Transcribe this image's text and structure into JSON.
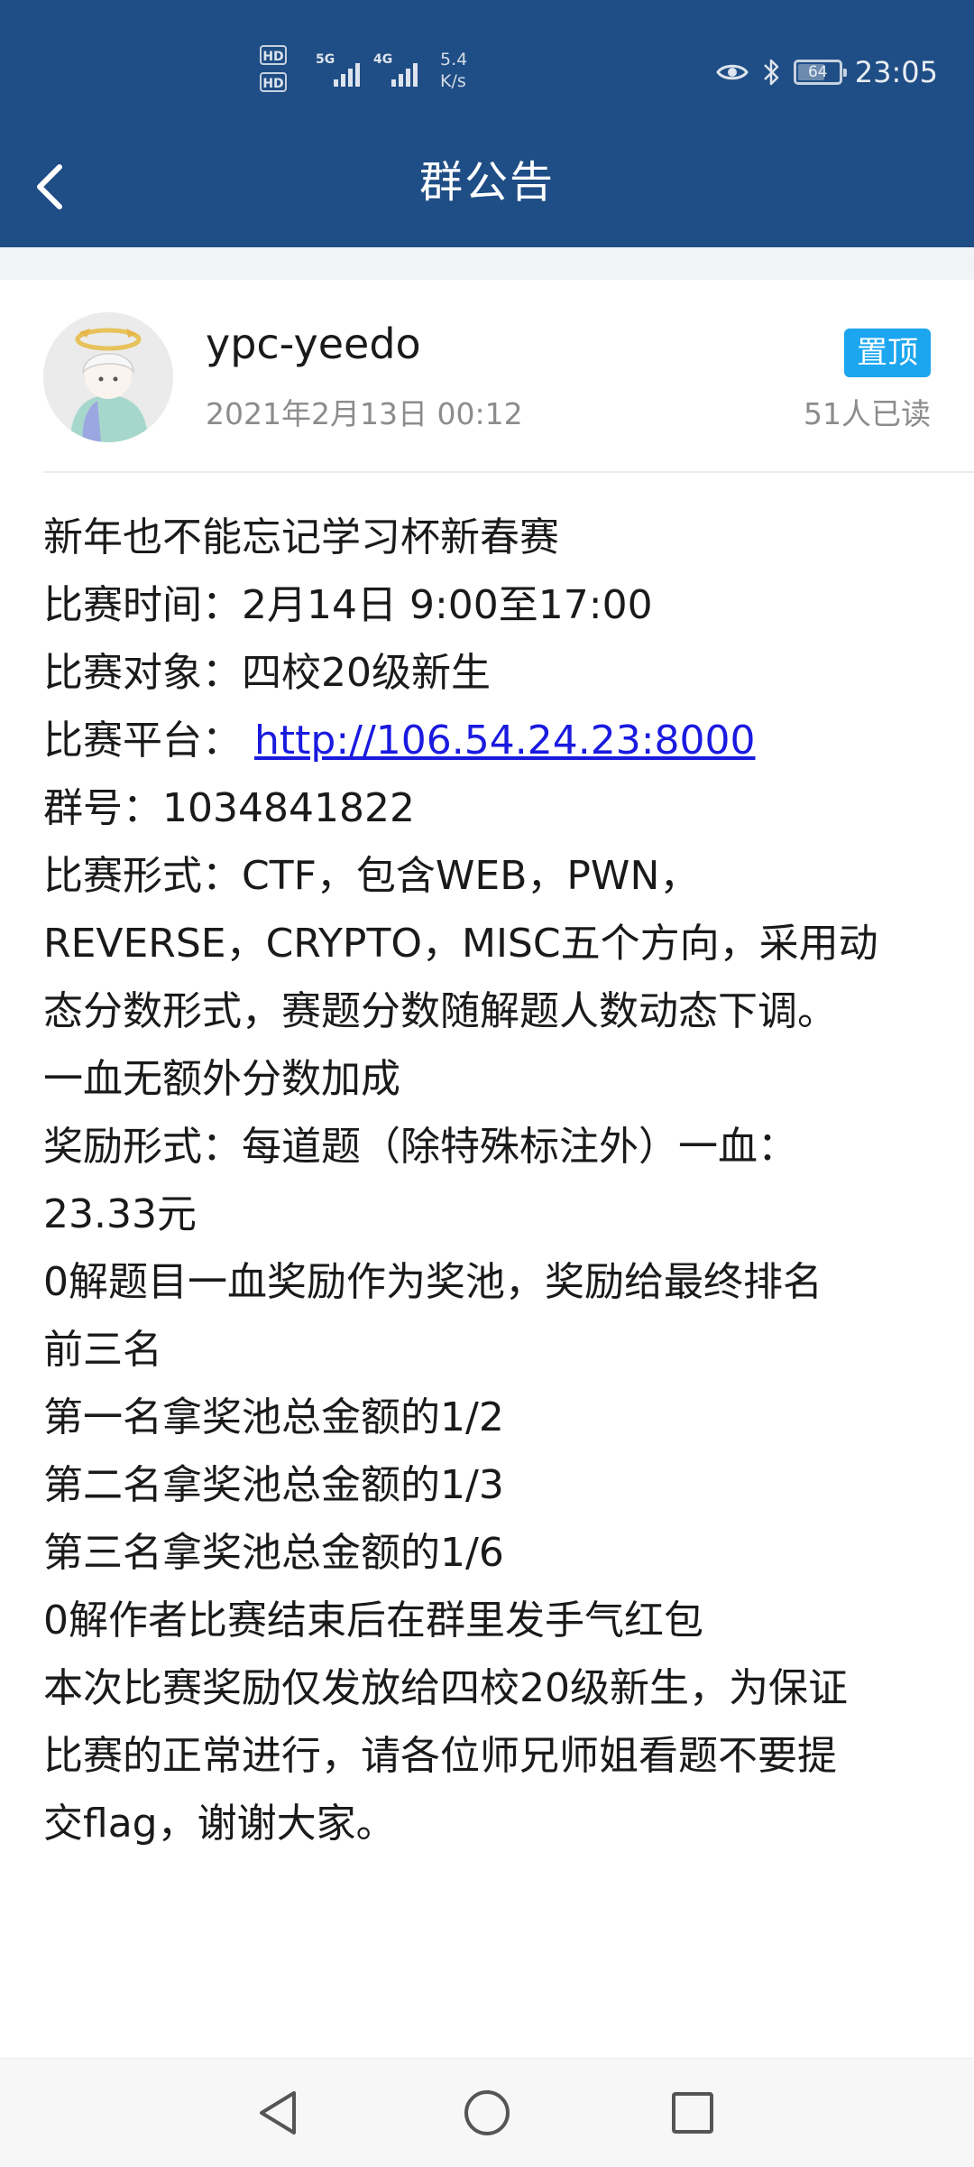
{
  "status_bar": {
    "hd_labels": [
      "HD",
      "HD"
    ],
    "network_5g": "5G",
    "network_4g": "4G",
    "speed_value": "5.4",
    "speed_unit": "K/s",
    "battery": "64",
    "time": "23:05",
    "icons": [
      "eye-icon",
      "bluetooth-icon",
      "battery-icon"
    ]
  },
  "header": {
    "title": "群公告",
    "back_icon": "back-chevron-icon"
  },
  "announcement": {
    "author": "ypc-yeedo",
    "timestamp": "2021年2月13日 00:12",
    "pinned_label": "置顶",
    "read_count": "51人已读",
    "lines": [
      "新年也不能忘记学习杯新春赛",
      "比赛时间：2月14日 9:00至17:00",
      "比赛对象：四校20级新生",
      "比赛平台：",
      "群号：1034841822",
      "比赛形式：CTF，包含WEB，PWN，",
      "REVERSE，CRYPTO，MISC五个方向，采用动",
      "态分数形式，赛题分数随解题人数动态下调。",
      "一血无额外分数加成",
      "奖励形式：每道题（除特殊标注外）一血：",
      "23.33元",
      "0解题目一血奖励作为奖池，奖励给最终排名",
      "前三名",
      "第一名拿奖池总金额的1/2",
      "第二名拿奖池总金额的1/3",
      "第三名拿奖池总金额的1/6",
      "0解作者比赛结束后在群里发手气红包",
      "本次比赛奖励仅发放给四校20级新生，为保证",
      "比赛的正常进行，请各位师兄师姐看题不要提",
      "交flag，谢谢大家。"
    ],
    "platform_link": "http://106.54.24.23:8000"
  },
  "nav_bar": {
    "icons": [
      "back-triangle-icon",
      "home-circle-icon",
      "recents-square-icon"
    ]
  },
  "colors": {
    "header_bg": "#1f4d85",
    "pin_badge": "#1ba6ef",
    "link": "#1a1adf",
    "meta_text": "#8c8c8c"
  }
}
